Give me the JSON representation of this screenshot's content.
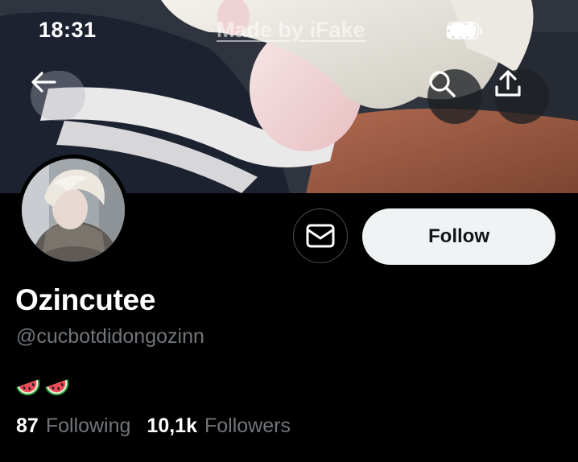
{
  "status_bar": {
    "time": "18:31",
    "watermark": "Made by iFake"
  },
  "icons": {
    "back": "arrow-left-icon",
    "search": "search-icon",
    "share": "share-upload-icon",
    "message": "mail-icon",
    "signal": "signal-bars-icon",
    "wifi": "wifi-icon",
    "battery": "battery-icon"
  },
  "profile": {
    "display_name": "Ozincutee",
    "handle": "@cucbotdidongozinn",
    "bio_emoji": [
      "🍉",
      "🍉"
    ],
    "follow_label": "Follow",
    "following_count": "87",
    "following_label": "Following",
    "followers_count": "10,1k",
    "followers_label": "Followers"
  },
  "colors": {
    "background": "#000000",
    "secondary_text": "#71767b",
    "follow_bg": "#eff3f4",
    "follow_text": "#0f1419"
  }
}
